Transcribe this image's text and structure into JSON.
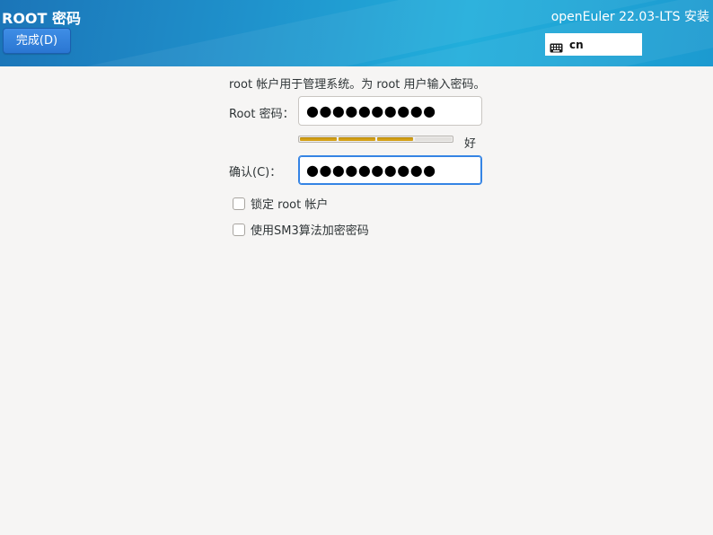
{
  "header": {
    "page_title": "ROOT 密码",
    "done_button_label": "完成(D)",
    "product_title": "openEuler 22.03-LTS 安装",
    "keyboard_layout": "cn",
    "keyboard_icon": "keyboard-icon"
  },
  "form": {
    "description": "root 帐户用于管理系统。为 root 用户输入密码。",
    "password_label": "Root 密码：",
    "password_value": "●●●●●●●●●●",
    "strength_segments_total": 4,
    "strength_segments_filled": 3,
    "strength_text": "好",
    "strength_color": "#d4a017",
    "confirm_label": "确认(C)：",
    "confirm_value": "●●●●●●●●●●",
    "lock_root_label": "锁定 root 帐户",
    "lock_root_checked": false,
    "sm3_label": "使用SM3算法加密密码",
    "sm3_checked": false
  },
  "colors": {
    "header_gradient_start": "#1b75b8",
    "header_gradient_end": "#21aedb",
    "accent": "#3584e4",
    "background": "#f6f5f4"
  }
}
